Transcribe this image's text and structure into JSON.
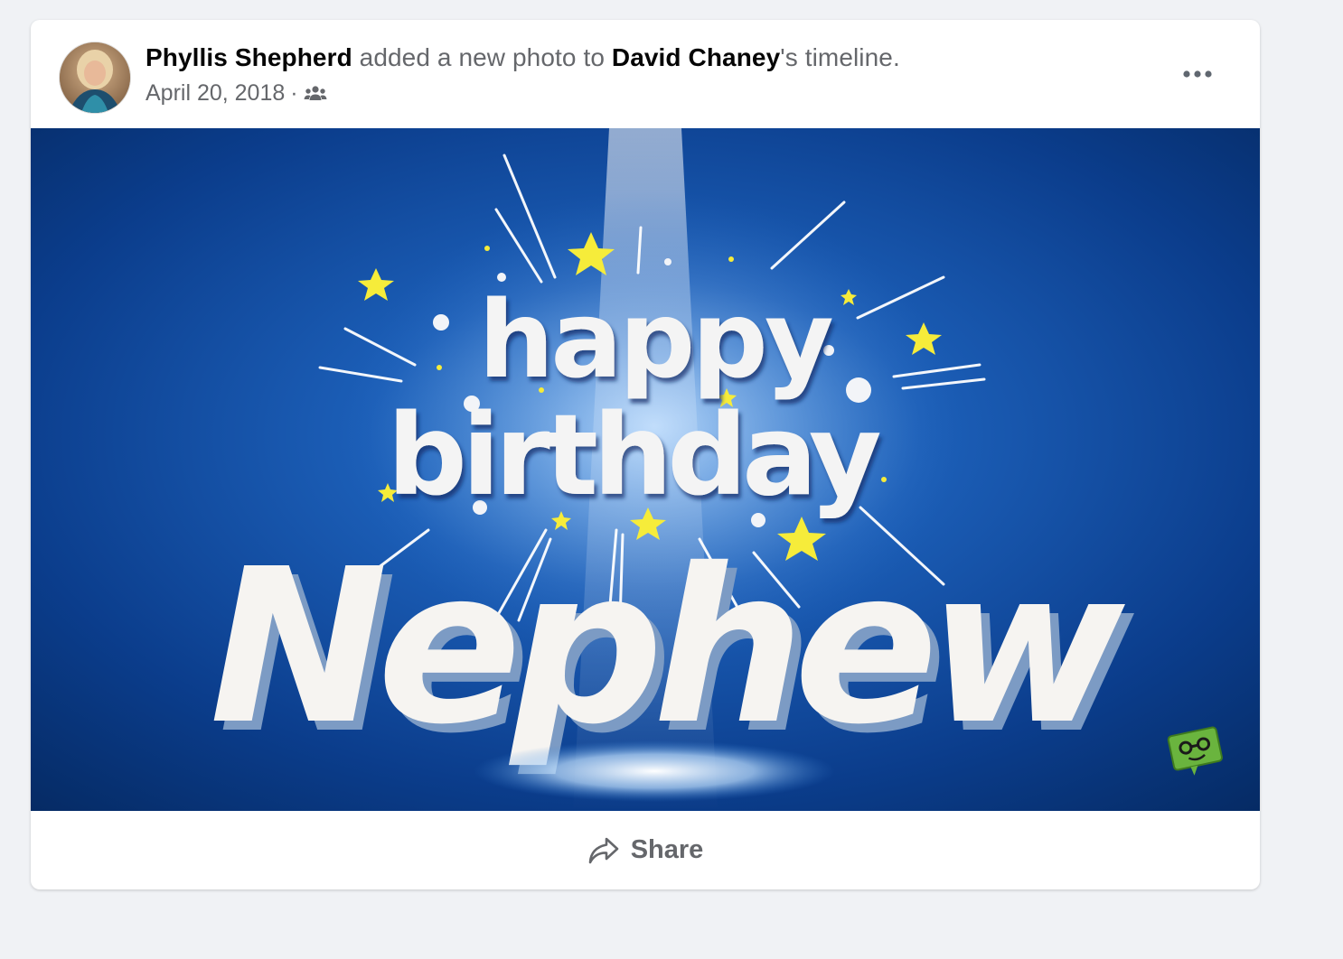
{
  "post": {
    "author": "Phyllis Shepherd",
    "action_text": " added a new photo to ",
    "target": "David Chaney",
    "suffix": "'s timeline.",
    "date": "April 20, 2018",
    "separator": "·",
    "audience_icon": "friends-icon",
    "more_icon": "more-options-icon"
  },
  "photo": {
    "line1": "happy",
    "line2": "birthday",
    "line3": "Nephew",
    "bg_color": "#0d3f8f",
    "text_color": "#f4f4f4",
    "star_color": "#f6ec3a"
  },
  "actions": {
    "share_label": "Share",
    "share_icon": "share-arrow-icon"
  }
}
